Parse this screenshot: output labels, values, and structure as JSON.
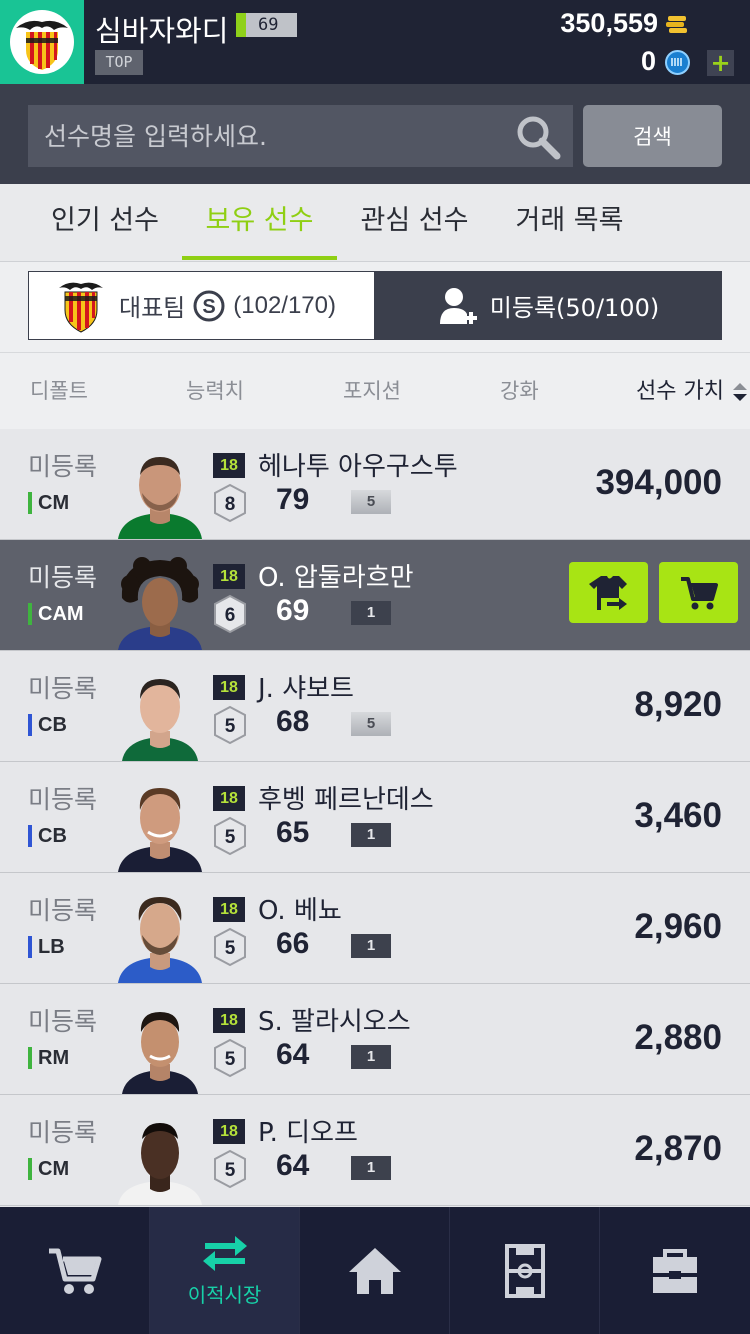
{
  "header": {
    "club_name": "심바자와디",
    "level": "69",
    "rank_badge": "TOP",
    "coins": "350,559",
    "gems": "0",
    "add_label": "+",
    "colors": {
      "bg": "#1f2334",
      "logo_bg": "#19c495",
      "accent": "#8fd11a"
    }
  },
  "search": {
    "placeholder": "선수명을 입력하세요.",
    "button_label": "검색"
  },
  "tabs": [
    {
      "label": "인기 선수",
      "active": false
    },
    {
      "label": "보유 선수",
      "active": true
    },
    {
      "label": "관심 선수",
      "active": false
    },
    {
      "label": "거래 목록",
      "active": false
    }
  ],
  "team_selector": {
    "team_label": "대표팀",
    "team_count": "(102/170)",
    "unregistered_label": "미등록(50/100)"
  },
  "sort": {
    "options": [
      "디폴트",
      "능력치",
      "포지션",
      "강화",
      "선수 가치"
    ],
    "active": "선수 가치"
  },
  "players": [
    {
      "status": "미등록",
      "position": "CM",
      "pos_color": "#3fb43f",
      "season": "18",
      "name": "헤나투 아우구스투",
      "grade": "8",
      "ovr": "79",
      "enhance": "5",
      "price": "394,000",
      "selected": false
    },
    {
      "status": "미등록",
      "position": "CAM",
      "pos_color": "#3fb43f",
      "season": "18",
      "name": "O. 압둘라흐만",
      "grade": "6",
      "ovr": "69",
      "enhance": "1",
      "price": "",
      "selected": true
    },
    {
      "status": "미등록",
      "position": "CB",
      "pos_color": "#2f55d4",
      "season": "18",
      "name": "J. 샤보트",
      "grade": "5",
      "ovr": "68",
      "enhance": "5",
      "price": "8,920",
      "selected": false
    },
    {
      "status": "미등록",
      "position": "CB",
      "pos_color": "#2f55d4",
      "season": "18",
      "name": "후벵 페르난데스",
      "grade": "5",
      "ovr": "65",
      "enhance": "1",
      "price": "3,460",
      "selected": false
    },
    {
      "status": "미등록",
      "position": "LB",
      "pos_color": "#2f55d4",
      "season": "18",
      "name": "O. 베뇨",
      "grade": "5",
      "ovr": "66",
      "enhance": "1",
      "price": "2,960",
      "selected": false
    },
    {
      "status": "미등록",
      "position": "RM",
      "pos_color": "#3fb43f",
      "season": "18",
      "name": "S. 팔라시오스",
      "grade": "5",
      "ovr": "64",
      "enhance": "1",
      "price": "2,880",
      "selected": false
    },
    {
      "status": "미등록",
      "position": "CM",
      "pos_color": "#3fb43f",
      "season": "18",
      "name": "P. 디오프",
      "grade": "5",
      "ovr": "64",
      "enhance": "1",
      "price": "2,870",
      "selected": false
    }
  ],
  "row_actions": [
    "shirt-transfer-icon",
    "cart-icon"
  ],
  "bottom_nav": [
    {
      "icon": "cart-icon",
      "label": ""
    },
    {
      "icon": "transfer-arrows-icon",
      "label": "이적시장",
      "active": true
    },
    {
      "icon": "home-icon",
      "label": ""
    },
    {
      "icon": "pitch-icon",
      "label": ""
    },
    {
      "icon": "locker-icon",
      "label": ""
    }
  ]
}
